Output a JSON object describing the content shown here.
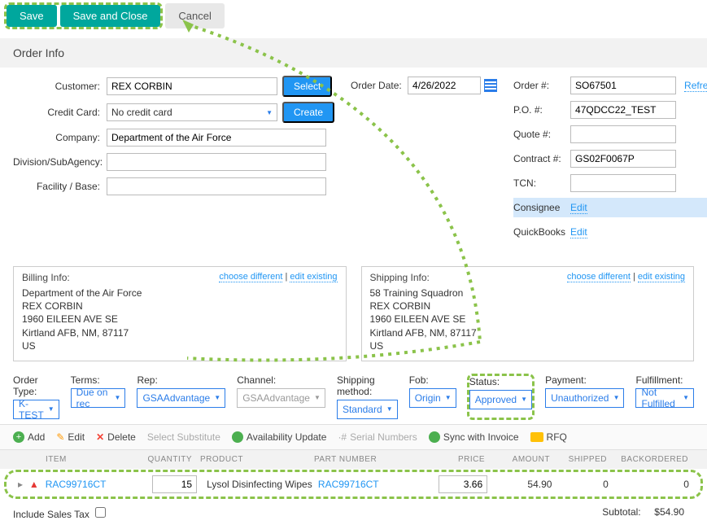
{
  "toolbar": {
    "save": "Save",
    "save_close": "Save and Close",
    "cancel": "Cancel"
  },
  "section": {
    "order_info": "Order Info"
  },
  "labels": {
    "customer": "Customer:",
    "credit_card": "Credit Card:",
    "company": "Company:",
    "division": "Division/SubAgency:",
    "facility": "Facility / Base:",
    "order_date": "Order Date:",
    "order_no": "Order #:",
    "po": "P.O. #:",
    "quote": "Quote #:",
    "contract": "Contract #:",
    "tcn": "TCN:",
    "consignee": "Consignee",
    "quickbooks": "QuickBooks"
  },
  "buttons": {
    "select": "Select",
    "create": "Create",
    "refresh": "Refresh",
    "edit": "Edit"
  },
  "values": {
    "customer": "REX CORBIN",
    "credit_card": "No credit card",
    "company": "Department of the Air Force",
    "division": "",
    "facility": "",
    "order_date": "4/26/2022",
    "order_no": "SO67501",
    "po": "47QDCC22_TEST",
    "quote": "",
    "contract": "GS02F0067P",
    "tcn": ""
  },
  "billing": {
    "title": "Billing Info:",
    "choose": "choose different",
    "edit": "edit existing",
    "lines": [
      "Department of the Air Force",
      "REX CORBIN",
      "1960 EILEEN AVE SE",
      "Kirtland AFB, NM, 87117",
      "US"
    ]
  },
  "shipping": {
    "title": "Shipping Info:",
    "choose": "choose different",
    "edit": "edit existing",
    "lines": [
      "58 Training Squadron",
      "REX CORBIN",
      "1960 EILEEN AVE SE",
      "Kirtland AFB, NM, 87117",
      "US"
    ]
  },
  "selects": {
    "order_type": {
      "label": "Order Type:",
      "value": "K-TEST"
    },
    "terms": {
      "label": "Terms:",
      "value": "Due on rec"
    },
    "rep": {
      "label": "Rep:",
      "value": "GSAAdvantage"
    },
    "channel": {
      "label": "Channel:",
      "value": "GSAAdvantage"
    },
    "shipmethod": {
      "label": "Shipping method:",
      "value": "Standard"
    },
    "fob": {
      "label": "Fob:",
      "value": "Origin"
    },
    "status": {
      "label": "Status:",
      "value": "Approved"
    },
    "payment": {
      "label": "Payment:",
      "value": "Unauthorized"
    },
    "fulfillment": {
      "label": "Fulfillment:",
      "value": "Not Fulfilled"
    }
  },
  "actions": {
    "add": "Add",
    "edit": "Edit",
    "delete": "Delete",
    "substitute": "Select Substitute",
    "avail": "Availability Update",
    "serial": "Serial Numbers",
    "sync": "Sync with Invoice",
    "rfq": "RFQ"
  },
  "grid": {
    "headers": {
      "item": "ITEM",
      "qty": "QUANTITY",
      "product": "PRODUCT",
      "pn": "PART NUMBER",
      "price": "PRICE",
      "amount": "AMOUNT",
      "shipped": "SHIPPED",
      "bo": "BACKORDERED"
    },
    "row": {
      "item": "RAC99716CT",
      "qty": "15",
      "product": "Lysol Disinfecting Wipes",
      "pn": "RAC99716CT",
      "price": "3.66",
      "amount": "54.90",
      "shipped": "0",
      "bo": "0"
    }
  },
  "footer": {
    "tax": "Include Sales Tax",
    "subtotal_label": "Subtotal:",
    "subtotal": "$54.90"
  }
}
